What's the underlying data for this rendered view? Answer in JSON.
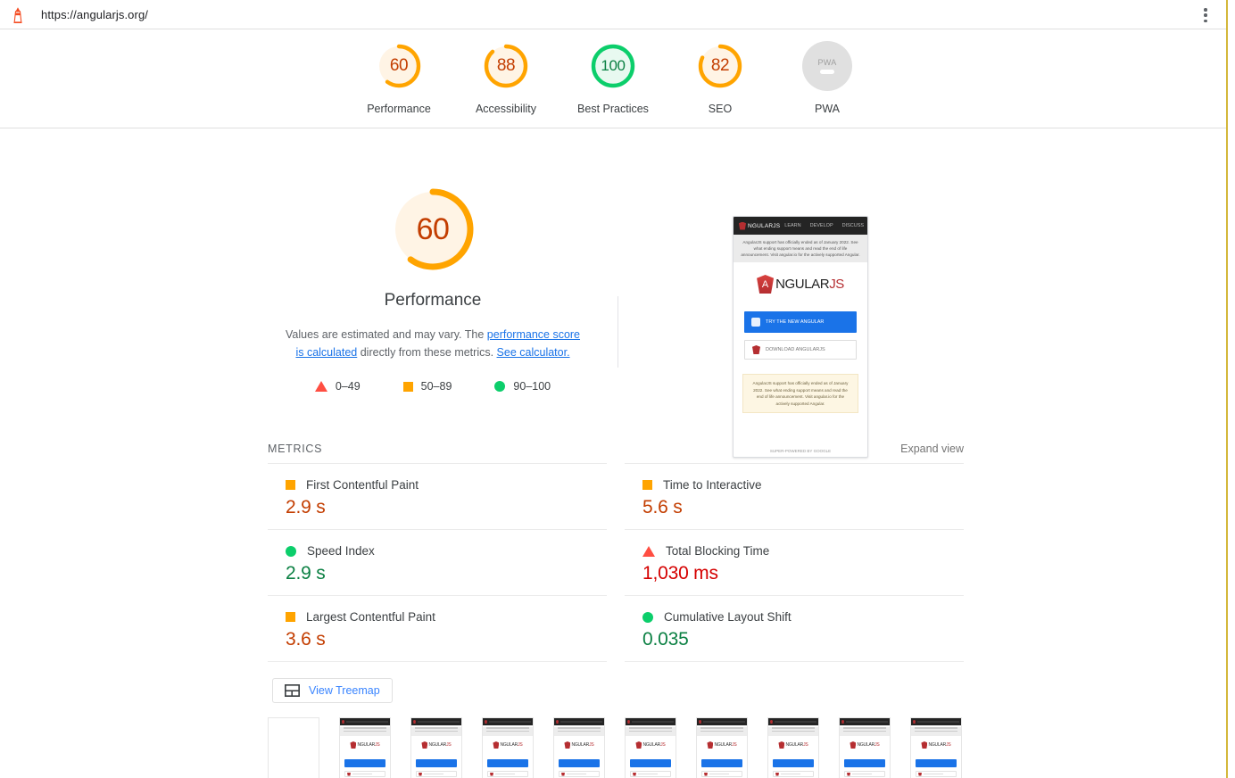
{
  "browser": {
    "url": "https://angularjs.org/",
    "lighthouse_icon": "lighthouse-icon",
    "menu_icon": "kebab-menu-icon"
  },
  "score_strip": {
    "categories": [
      {
        "label": "Performance",
        "score": "60",
        "color": "#ffa400",
        "fill": "#fff4e5",
        "type": "average"
      },
      {
        "label": "Accessibility",
        "score": "88",
        "color": "#ffa400",
        "fill": "#fff4e5",
        "type": "average"
      },
      {
        "label": "Best Practices",
        "score": "100",
        "color": "#0cce6b",
        "fill": "#e8f9f0",
        "type": "pass"
      },
      {
        "label": "SEO",
        "score": "82",
        "color": "#ffa400",
        "fill": "#fff4e5",
        "type": "average"
      },
      {
        "label": "PWA",
        "score": "",
        "color": "#e0e0e0",
        "fill": "#e0e0e0",
        "type": "null",
        "badge": "PWA"
      }
    ]
  },
  "hero": {
    "gauge_score": "60",
    "gauge_color": "#ffa400",
    "gauge_fill": "#fff4e5",
    "title": "Performance",
    "description_pre": "Values are estimated and may vary. The ",
    "description_link1": "performance score is calculated",
    "description_mid": " directly from these metrics. ",
    "description_link2": "See calculator.",
    "legend": [
      {
        "icon": "triangle",
        "range": "0–49",
        "color": "#ff4e42"
      },
      {
        "icon": "square",
        "range": "50–89",
        "color": "#ffa400"
      },
      {
        "icon": "circle",
        "range": "90–100",
        "color": "#0cce6b"
      }
    ]
  },
  "screenshot_card": {
    "nav_brand": "NGULARJS",
    "nav_links": [
      "LEARN",
      "DEVELOP",
      "DISCUSS"
    ],
    "banner": "AngularJS support has officially ended as of January 2022. See what ending support means and read the end of life announcement. Visit angular.io for the actively supported Angular.",
    "hero_word": "NGULAR",
    "hero_word_accent": "JS",
    "button_primary": "TRY THE NEW ANGULAR",
    "button_secondary": "DOWNLOAD ANGULARJS",
    "note": "AngularJS support has officially ended as of January 2022. See what ending support means and read the end of life announcement. Visit angular.io for the actively supported Angular.",
    "footer": "SUPER-POWERED BY GOOGLE"
  },
  "metrics_section": {
    "title": "METRICS",
    "expand_label": "Expand view",
    "metrics": [
      {
        "name": "First Contentful Paint",
        "value": "2.9 s",
        "rating": "average",
        "icon": "square",
        "value_color": "#c33d00"
      },
      {
        "name": "Time to Interactive",
        "value": "5.6 s",
        "rating": "average",
        "icon": "square",
        "value_color": "#c33d00"
      },
      {
        "name": "Speed Index",
        "value": "2.9 s",
        "rating": "pass",
        "icon": "circle",
        "value_color": "#0b8043"
      },
      {
        "name": "Total Blocking Time",
        "value": "1,030 ms",
        "rating": "fail",
        "icon": "triangle",
        "value_color": "#d50000"
      },
      {
        "name": "Largest Contentful Paint",
        "value": "3.6 s",
        "rating": "average",
        "icon": "square",
        "value_color": "#c33d00"
      },
      {
        "name": "Cumulative Layout Shift",
        "value": "0.035",
        "rating": "pass",
        "icon": "circle",
        "value_color": "#0b8043"
      }
    ],
    "treemap_button": {
      "label": "View Treemap",
      "icon": "treemap-icon"
    }
  },
  "filmstrip": {
    "frames": [
      {
        "state": "blank"
      },
      {
        "state": "loaded"
      },
      {
        "state": "loaded"
      },
      {
        "state": "loaded"
      },
      {
        "state": "loaded"
      },
      {
        "state": "loaded"
      },
      {
        "state": "loaded"
      },
      {
        "state": "loaded"
      },
      {
        "state": "loaded"
      },
      {
        "state": "loaded"
      }
    ]
  }
}
